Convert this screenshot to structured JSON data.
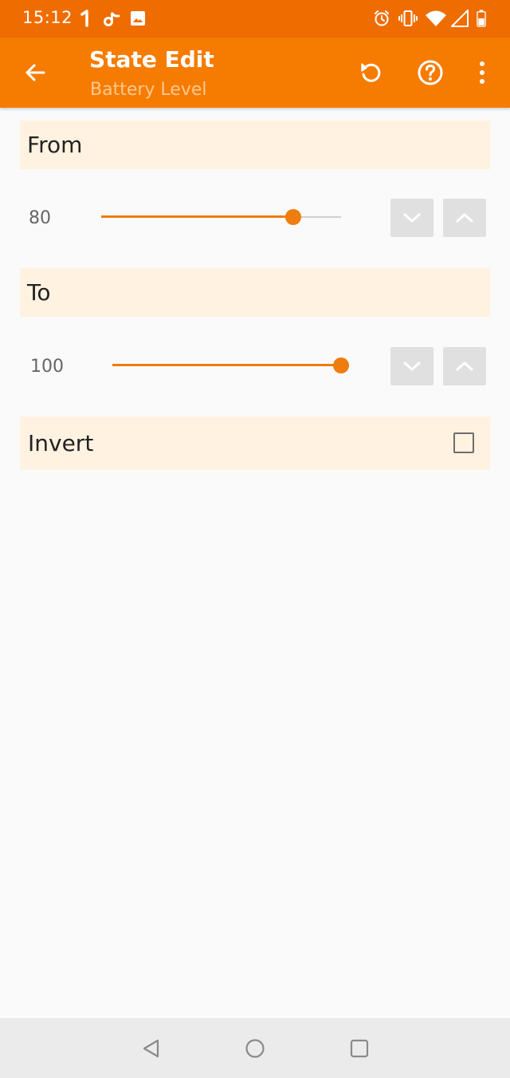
{
  "status_bar": {
    "time": "15:12",
    "left_icons": [
      "notification-1-icon",
      "tiktok-icon",
      "image-icon"
    ],
    "right_icons": [
      "alarm-icon",
      "vibrate-icon",
      "wifi-icon",
      "signal-icon",
      "battery-icon"
    ]
  },
  "app_bar": {
    "title": "State Edit",
    "subtitle": "Battery Level",
    "back_icon": "arrow-left-icon",
    "actions": [
      "undo-icon",
      "help-icon",
      "more-vert-icon"
    ]
  },
  "from": {
    "label": "From",
    "value": "80",
    "slider_fraction": 0.8
  },
  "to": {
    "label": "To",
    "value": "100",
    "slider_fraction": 1.0
  },
  "invert": {
    "label": "Invert",
    "checked": false
  },
  "colors": {
    "status_bar": "#EF6C00",
    "app_bar": "#F57C00",
    "accent": "#EF7C0E",
    "section_bg": "#FFF2E1",
    "subtitle": "#FFC88F",
    "step_button": "#E0E0E0"
  },
  "nav_bar": {
    "icons": [
      "back-triangle-icon",
      "home-circle-icon",
      "recents-square-icon"
    ]
  }
}
